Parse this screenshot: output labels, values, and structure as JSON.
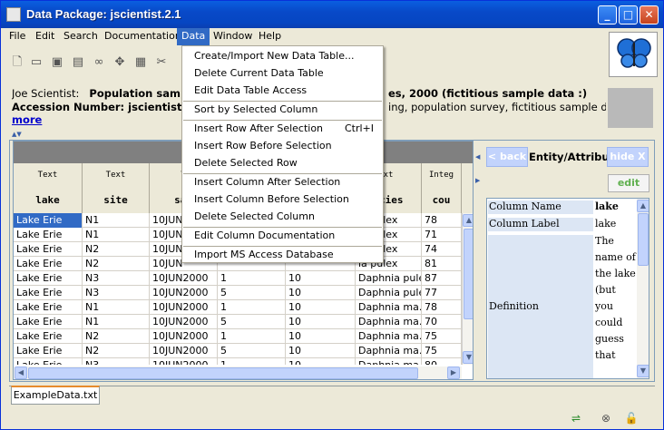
{
  "window": {
    "title": "Data Package:  jscientist.2.1",
    "controls": [
      "_",
      "□",
      "✕"
    ]
  },
  "menubar": {
    "items": [
      "File",
      "Edit",
      "Search",
      "Documentation",
      "Data",
      "Window",
      "Help"
    ],
    "active": "Data"
  },
  "toolbar": {
    "icons": [
      "new-document-icon",
      "open-folder-icon",
      "save-icon",
      "save-copy-icon",
      "search-binoculars-icon",
      "network-icon",
      "print-icon",
      "tools-icon"
    ]
  },
  "info": {
    "creator": "Joe Scientist:",
    "title_visible": "Population sample",
    "title_tail": "es, 2000 (fictitious sample data :)",
    "accession_label": "Accession Number: jscientist.2.",
    "keywords_tail": "ing, population survey, fictitious sample dat...",
    "more": "more"
  },
  "table": {
    "columns": [
      {
        "type": "Text",
        "name": "lake"
      },
      {
        "type": "Text",
        "name": "site"
      },
      {
        "type": "T",
        "name": "sam"
      },
      {
        "type": "",
        "name": ""
      },
      {
        "type": "",
        "name": ""
      },
      {
        "type": "xt",
        "name": "ecies"
      },
      {
        "type": "Integ",
        "name": "cou"
      }
    ],
    "rows": [
      [
        "Lake Erie",
        "N1",
        "10JUN",
        "",
        "",
        "ia pulex",
        "78"
      ],
      [
        "Lake Erie",
        "N1",
        "10JUN",
        "",
        "",
        "ia pulex",
        "71"
      ],
      [
        "Lake Erie",
        "N2",
        "10JUN",
        "",
        "",
        "ia pulex",
        "74"
      ],
      [
        "Lake Erie",
        "N2",
        "10JUN",
        "",
        "",
        "ia pulex",
        "81"
      ],
      [
        "Lake Erie",
        "N3",
        "10JUN2000",
        "1",
        "10",
        "Daphnia pulex",
        "87"
      ],
      [
        "Lake Erie",
        "N3",
        "10JUN2000",
        "5",
        "10",
        "Daphnia pulex",
        "77"
      ],
      [
        "Lake Erie",
        "N1",
        "10JUN2000",
        "1",
        "10",
        "Daphnia ma...",
        "78"
      ],
      [
        "Lake Erie",
        "N1",
        "10JUN2000",
        "5",
        "10",
        "Daphnia ma...",
        "70"
      ],
      [
        "Lake Erie",
        "N2",
        "10JUN2000",
        "1",
        "10",
        "Daphnia ma...",
        "75"
      ],
      [
        "Lake Erie",
        "N2",
        "10JUN2000",
        "5",
        "10",
        "Daphnia ma...",
        "75"
      ],
      [
        "Lake Erie",
        "N3",
        "10JUN2000",
        "1",
        "10",
        "Daphnia ma...",
        "80"
      ]
    ]
  },
  "attribute_panel": {
    "back": "< back",
    "title": "Entity/Attribute",
    "hide": "hide X",
    "edit": "edit",
    "fields": [
      {
        "key": "Column Name",
        "value": "lake"
      },
      {
        "key": "Column Label",
        "value": "lake"
      },
      {
        "key": "Definition",
        "value": "The name of the lake (but you could guess that"
      }
    ]
  },
  "tabs": [
    "ExampleData.txt"
  ],
  "data_menu": {
    "items": [
      {
        "label": "Create/Import New Data Table...",
        "accel": ""
      },
      {
        "label": "Delete Current Data Table",
        "accel": ""
      },
      {
        "label": "Edit Data Table Access",
        "accel": ""
      },
      {
        "label": "Sort by Selected Column",
        "accel": ""
      },
      {
        "label": "Insert Row After Selection",
        "accel": "Ctrl+I"
      },
      {
        "label": "Insert Row Before Selection",
        "accel": ""
      },
      {
        "label": "Delete Selected Row",
        "accel": ""
      },
      {
        "label": "Insert Column After Selection",
        "accel": ""
      },
      {
        "label": "Insert Column Before Selection",
        "accel": ""
      },
      {
        "label": "Delete Selected Column",
        "accel": ""
      },
      {
        "label": "Edit Column Documentation",
        "accel": ""
      },
      {
        "label": "Import MS Access Database",
        "accel": ""
      }
    ]
  },
  "colors": {
    "titlebar": "#0849c8",
    "selection": "#316ac5",
    "link": "#0000cc"
  }
}
